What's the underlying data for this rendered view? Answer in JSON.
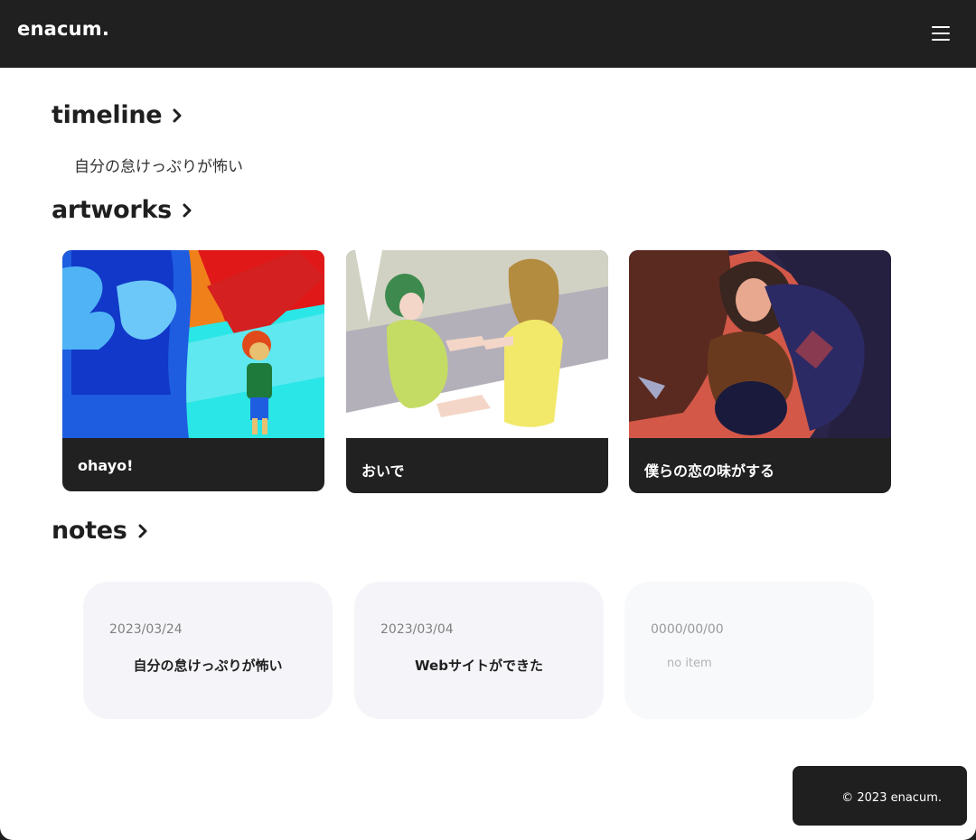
{
  "header": {
    "logo": "enacum.",
    "menu_icon": "hamburger-menu-icon"
  },
  "timeline": {
    "title": "timeline",
    "latest": "自分の怠けっぷりが怖い"
  },
  "artworks": {
    "title": "artworks",
    "items": [
      {
        "label": "ohayo!"
      },
      {
        "label": "おいで"
      },
      {
        "label": "僕らの恋の味がする"
      }
    ]
  },
  "notes": {
    "title": "notes",
    "items": [
      {
        "date": "2023/03/24",
        "title": "自分の怠けっぷりが怖い"
      },
      {
        "date": "2023/03/04",
        "title": "Webサイトができた"
      },
      {
        "date": "0000/00/00",
        "title": "no item"
      }
    ]
  },
  "footer": {
    "copyright": "© 2023 enacum."
  },
  "colors": {
    "header_bg": "#202020",
    "card_bg": "#212121",
    "note_bg": "#f5f5f9",
    "text": "#1f1f1f"
  }
}
